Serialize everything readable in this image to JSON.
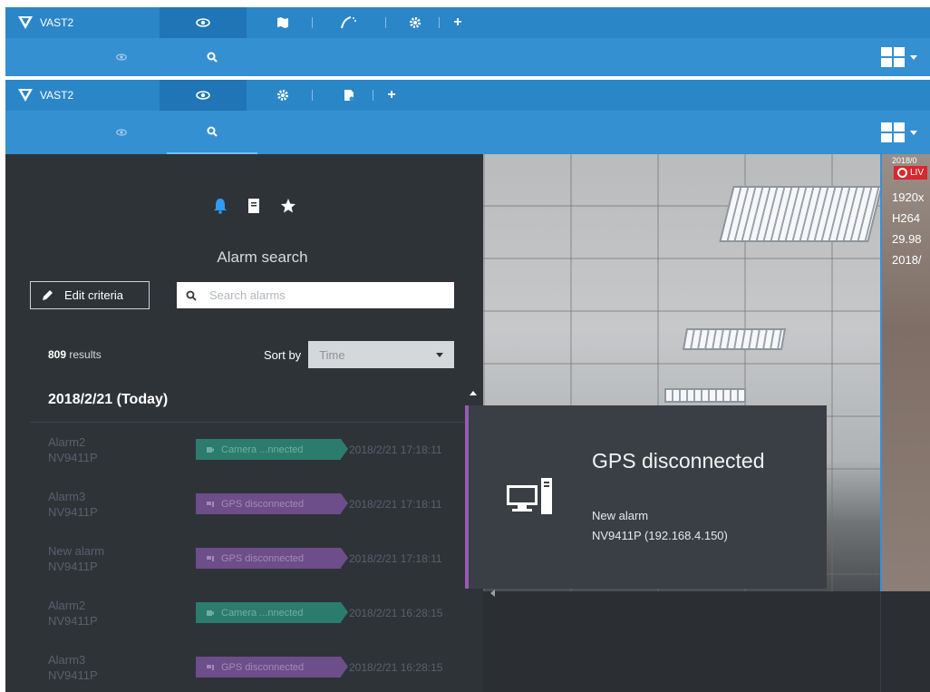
{
  "top_bar_1": {
    "brand": "VAST2",
    "tabs": [
      {
        "icon": "eye-icon",
        "glyph": "👁"
      },
      {
        "icon": "map-icon",
        "glyph": "🗺"
      },
      {
        "icon": "analytics-icon",
        "glyph": "☍"
      },
      {
        "icon": "gear-icon",
        "glyph": "⚙"
      },
      {
        "icon": "plus-icon",
        "glyph": "+"
      }
    ]
  },
  "sub_bar_1": {
    "tabs": [
      {
        "icon": "eye-icon"
      },
      {
        "icon": "search-icon"
      }
    ]
  },
  "top_bar_2": {
    "brand": "VAST2",
    "tabs": [
      {
        "icon": "eye-icon"
      },
      {
        "icon": "gear-icon"
      },
      {
        "icon": "file-settings-icon"
      },
      {
        "icon": "plus-icon",
        "glyph": "+"
      }
    ]
  },
  "sub_bar_2": {
    "tabs": [
      {
        "icon": "eye-icon"
      },
      {
        "icon": "search-icon"
      }
    ]
  },
  "panel": {
    "icons": [
      "bell-icon",
      "document-icon",
      "star-icon"
    ],
    "title": "Alarm search",
    "edit_label": "Edit criteria",
    "search_placeholder": "Search alarms",
    "results_count": "809",
    "results_label": "results",
    "sort_label": "Sort by",
    "sort_value": "Time",
    "date_header": "2018/2/21 (Today)"
  },
  "alarms": [
    {
      "name": "Alarm2",
      "device": "NV9411P",
      "type": "camera",
      "tag": "Camera ...nnected",
      "time": "2018/2/21 17:18:11"
    },
    {
      "name": "Alarm3",
      "device": "NV9411P",
      "type": "gps",
      "tag": "GPS disconnected",
      "time": "2018/2/21 17:18:11"
    },
    {
      "name": "New alarm",
      "device": "NV9411P",
      "type": "gps",
      "tag": "GPS disconnected",
      "time": "2018/2/21 17:18:11"
    },
    {
      "name": "Alarm2",
      "device": "NV9411P",
      "type": "camera",
      "tag": "Camera ...nnected",
      "time": "2018/2/21 16:28:15"
    },
    {
      "name": "Alarm3",
      "device": "NV9411P",
      "type": "gps",
      "tag": "GPS disconnected",
      "time": "2018/2/21 16:28:15"
    }
  ],
  "popup": {
    "title": "GPS disconnected",
    "alarm_name": "New alarm",
    "device": "NV9411P (192.168.4.150)",
    "accent": "#9b59b6"
  },
  "live_view": {
    "timestamp": "2018/0",
    "badge": "LIV",
    "resolution": "1920x",
    "codec": "H264",
    "fps": "29.98",
    "date": "2018/"
  },
  "colors": {
    "top_bar": "#2b86c8",
    "sub_bar": "#3590d1",
    "panel_bg": "#2e3338",
    "camera_tag": "#2b7c6c",
    "gps_tag": "#6d4d8a"
  }
}
